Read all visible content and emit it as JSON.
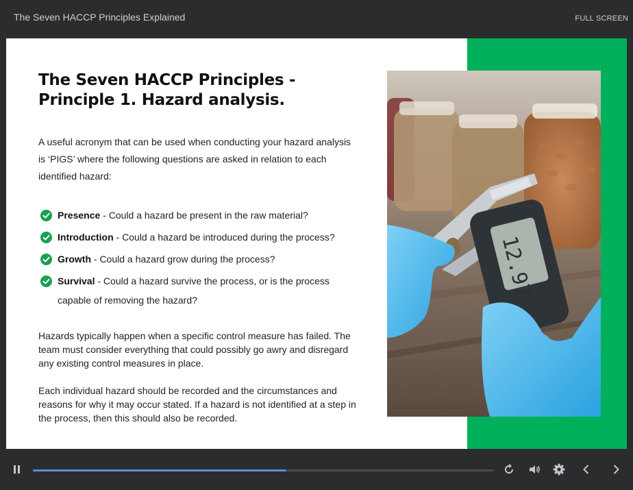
{
  "header": {
    "course_title": "The Seven HACCP Principles Explained",
    "fullscreen_label": "FULL SCREEN"
  },
  "slide": {
    "heading": "The Seven HACCP Principles - Principle 1. Hazard analysis.",
    "intro": "A useful acronym that can be used when conducting your hazard analysis is ‘PIGS’ where the following questions are asked in relation to each identified hazard:",
    "items": [
      {
        "term": "Presence",
        "text": " - Could a hazard be present in the raw material?"
      },
      {
        "term": "Introduction",
        "text": " - Could a hazard be introduced during the process?"
      },
      {
        "term": "Growth",
        "text": " - Could a hazard grow during the process?"
      },
      {
        "term": "Survival",
        "text": " - Could a hazard survive the process, or is the process capable of removing the hazard?"
      }
    ],
    "paragraph_1": "Hazards typically happen when a specific control measure has failed. The team must consider everything that could possibly go awry and disregard any existing control measures in place.",
    "paragraph_2": "Each individual hazard should be recorded and the circumstances and reasons for why it may occur stated. If a hazard is not identified at a step in the process, then this should also be recorded.",
    "caliper_reading": "12.97"
  },
  "player": {
    "progress_percent": 55,
    "icons": [
      "pause-icon",
      "replay-icon",
      "volume-icon",
      "settings-gear-icon",
      "chevron-left-icon",
      "chevron-right-icon"
    ]
  },
  "colors": {
    "accent_green": "#00b05a",
    "check_green": "#1aa053",
    "progress_blue": "#5b8fd1",
    "chrome": "#2b2c2e"
  }
}
